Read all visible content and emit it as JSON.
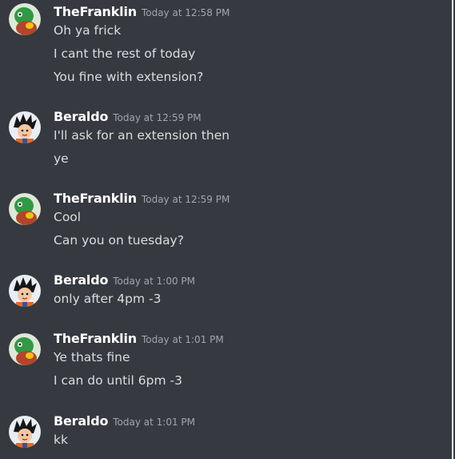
{
  "users": {
    "franklin": {
      "name": "TheFranklin",
      "avatar_icon": "green-turtle-avatar-icon",
      "avatar_bg": "#1f8b36"
    },
    "beraldo": {
      "name": "Beraldo",
      "avatar_icon": "goku-avatar-icon",
      "avatar_bg": "#3a86c9"
    }
  },
  "messages": [
    {
      "author": "TheFranklin",
      "timestamp": "Today at 12:58 PM",
      "lines": [
        "Oh ya frick",
        "I cant the rest of today",
        "You fine with extension?"
      ]
    },
    {
      "author": "Beraldo",
      "timestamp": "Today at 12:59 PM",
      "lines": [
        "I'll ask for an extension then",
        "ye"
      ]
    },
    {
      "author": "TheFranklin",
      "timestamp": "Today at 12:59 PM",
      "lines": [
        "Cool",
        "Can you on tuesday?"
      ]
    },
    {
      "author": "Beraldo",
      "timestamp": "Today at 1:00 PM",
      "lines": [
        "only after 4pm -3"
      ]
    },
    {
      "author": "TheFranklin",
      "timestamp": "Today at 1:01 PM",
      "lines": [
        "Ye thats fine",
        "I can do until 6pm -3"
      ]
    },
    {
      "author": "Beraldo",
      "timestamp": "Today at 1:01 PM",
      "lines": [
        "kk"
      ]
    }
  ],
  "colors": {
    "background": "#36393f",
    "username": "#ffffff",
    "timestamp": "#a3a6aa",
    "message_text": "#dcddde"
  }
}
